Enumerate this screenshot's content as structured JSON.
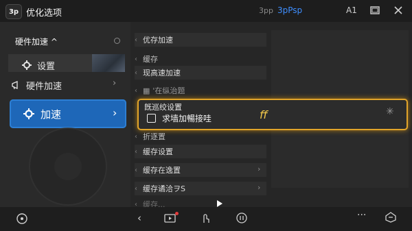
{
  "titlebar": {
    "logo": "3p",
    "title": "优化选项",
    "version_sub": "3pp",
    "version_main": "3pPsp",
    "window_label": "A1",
    "accent_color": "#3f8fff"
  },
  "sidebar": {
    "header": "硬件加速 ^",
    "items": [
      {
        "label": "设置",
        "icon": "gear-icon"
      },
      {
        "label": "硬件加速",
        "icon": "megaphone-icon"
      }
    ],
    "active": {
      "label": "加速",
      "icon": "gear-icon"
    },
    "active_color": "#1e67b8"
  },
  "main": {
    "header": "优存加速",
    "rows": [
      {
        "label": "缓存",
        "kind": "section"
      },
      {
        "label": "现高速加速",
        "kind": "item"
      },
      {
        "label": "'在纵治题",
        "kind": "item"
      },
      {
        "label": "折逐置",
        "kind": "section"
      },
      {
        "label": "缓存设置",
        "kind": "item"
      },
      {
        "label": "缓存在逸置",
        "kind": "item"
      },
      {
        "label": "缓存谲洽ヲS",
        "kind": "item"
      },
      {
        "label": "缓存...",
        "kind": "item"
      }
    ],
    "highlight": {
      "heading": "旣巡绞设置",
      "text": "求墙加暢接哇",
      "symbol": "ff",
      "color": "#e2a52a"
    }
  },
  "bottom": {
    "left_icon": "compass-icon",
    "icons": [
      "back-icon",
      "media-icon",
      "touch-icon",
      "power-icon",
      "more-icon",
      "chat-icon"
    ]
  }
}
